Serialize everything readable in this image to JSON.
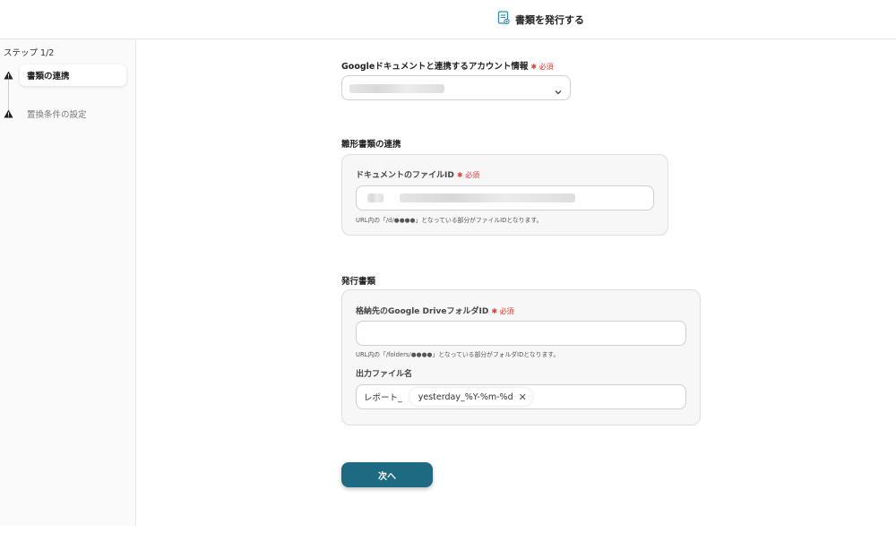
{
  "header": {
    "title": "書類を発行する",
    "icon": "document-icon"
  },
  "sidebar": {
    "step_count": "ステップ 1/2",
    "steps": [
      {
        "label": "書類の連携",
        "status": "active"
      },
      {
        "label": "置換条件の設定",
        "status": "inactive"
      }
    ]
  },
  "account": {
    "label": "Googleドキュメントと連携するアカウント情報",
    "required": "必須"
  },
  "template_section": {
    "title": "雛形書類の連携",
    "file_id_label": "ドキュメントのファイルID",
    "required": "必須",
    "hint": "URL内の「/d/●●●●」となっている部分がファイルIDとなります。"
  },
  "output_section": {
    "title": "発行書類",
    "folder_label": "格納先のGoogle DriveフォルダID",
    "required": "必須",
    "folder_value": "",
    "folder_hint": "URL内の「/folders/●●●●」となっている部分がフォルダIDとなります。",
    "filename_label": "出力ファイル名",
    "filename_prefix": "レポート_",
    "filename_chip": "yesterday_%Y-%m-%d"
  },
  "next_button": "次へ",
  "colors": {
    "primary": "#1e6a82",
    "required": "#e53935",
    "warning": "#222222"
  }
}
